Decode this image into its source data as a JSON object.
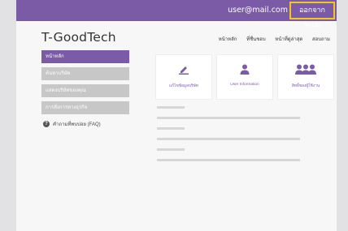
{
  "header": {
    "user_email": "user@mail.com",
    "logout_label": "ออกจากระบบ"
  },
  "logo": "T-GoodTech",
  "nav": {
    "items": [
      "หน้าหลัก",
      "ที่ชื่นชอบ",
      "หน้าที่ดูล่าสุด",
      "สอบถาม"
    ]
  },
  "sidebar": {
    "items": [
      {
        "label": "หน้าหลัก",
        "active": true
      },
      {
        "label": "ค้นหาบริษัท",
        "active": false
      },
      {
        "label": "แสดงบริษัทของคุณ",
        "active": false
      },
      {
        "label": "การสั่งการทางธุรกิจ",
        "active": false
      }
    ],
    "faq_label": "คำถามที่พบบ่อย (FAQ)"
  },
  "cards": [
    {
      "label": "แก้ไขข้อมูลบริษัท",
      "icon": "edit-icon"
    },
    {
      "label": "User Information",
      "icon": "user-icon"
    },
    {
      "label": "สิทธิ์ของผู้ใช้งาน",
      "icon": "users-group-icon"
    }
  ],
  "colors": {
    "brand": "#7b5aa6",
    "highlight": "#f2c71c",
    "sidebar_inactive": "#c7c7c8"
  }
}
